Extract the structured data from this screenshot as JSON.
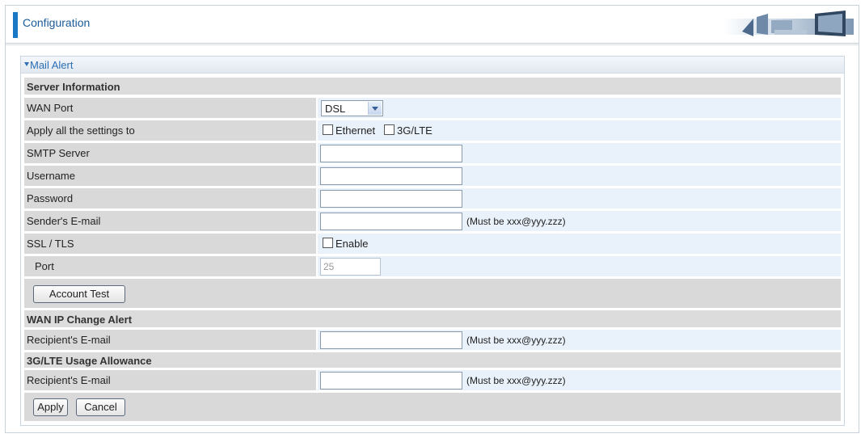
{
  "header": {
    "title": "Configuration"
  },
  "panel": {
    "title": "Mail Alert"
  },
  "server_info": {
    "section_label": "Server Information",
    "wan_port": {
      "label": "WAN Port",
      "selected": "DSL"
    },
    "apply_all": {
      "label": "Apply all the settings to",
      "options": [
        {
          "label": "Ethernet",
          "checked": false
        },
        {
          "label": "3G/LTE",
          "checked": false
        }
      ]
    },
    "smtp_server": {
      "label": "SMTP Server",
      "value": ""
    },
    "username": {
      "label": "Username",
      "value": ""
    },
    "password": {
      "label": "Password",
      "value": ""
    },
    "sender_email": {
      "label": "Sender's E-mail",
      "value": "",
      "hint": "(Must be xxx@yyy.zzz)"
    },
    "ssl_tls": {
      "label": "SSL / TLS",
      "enable_label": "Enable",
      "checked": false
    },
    "port": {
      "label": "Port",
      "value": "25"
    },
    "account_test_label": "Account Test"
  },
  "wan_ip_alert": {
    "section_label": "WAN IP Change Alert",
    "recipient": {
      "label": "Recipient's E-mail",
      "value": "",
      "hint": "(Must be xxx@yyy.zzz)"
    }
  },
  "usage_allowance": {
    "section_label": "3G/LTE Usage Allowance",
    "recipient": {
      "label": "Recipient's E-mail",
      "value": "",
      "hint": "(Must be xxx@yyy.zzz)"
    }
  },
  "actions": {
    "apply_label": "Apply",
    "cancel_label": "Cancel"
  },
  "colors": {
    "accent": "#1a78c4",
    "label_bg": "#d9d9d9",
    "value_bg": "#e9f2fb",
    "title_text": "#2b6fb5"
  }
}
